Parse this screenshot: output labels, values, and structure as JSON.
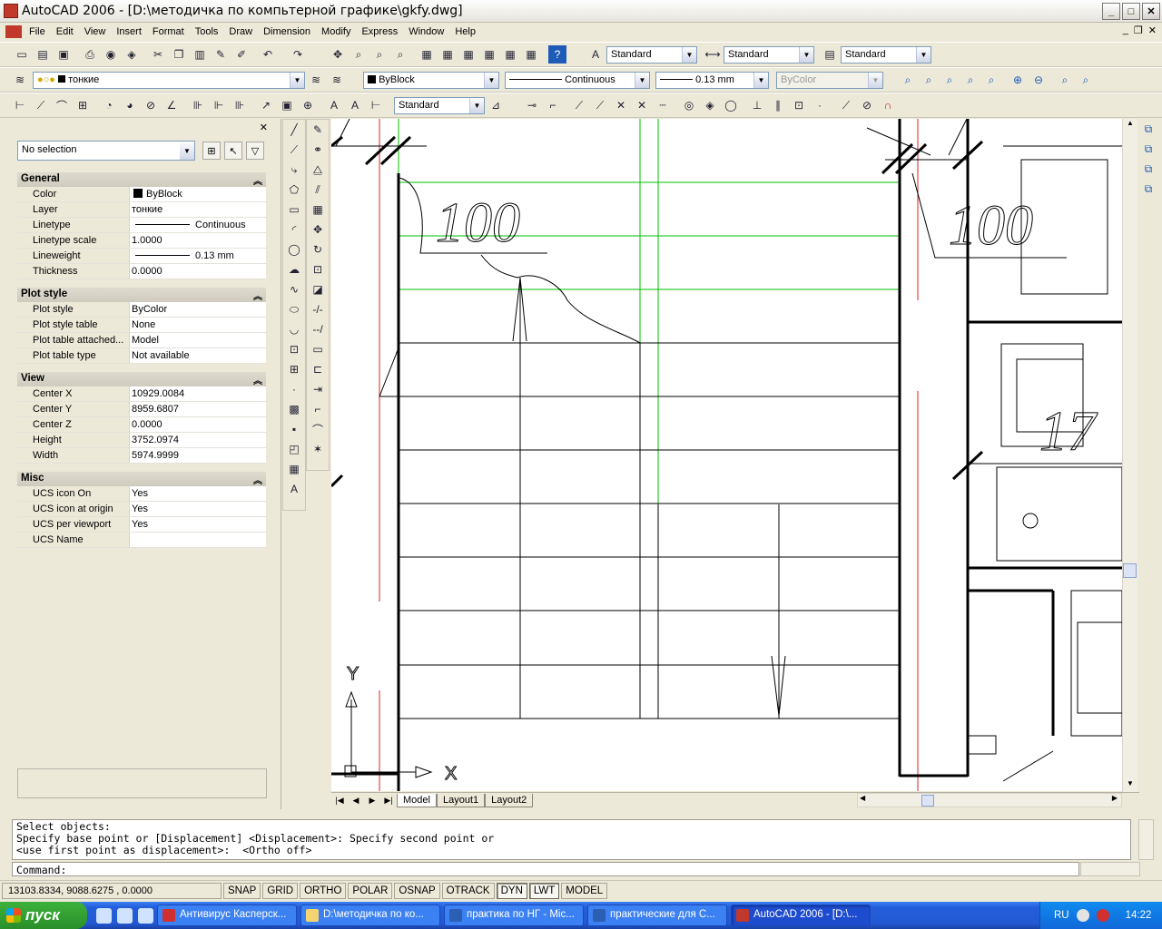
{
  "window": {
    "title": "AutoCAD 2006 - [D:\\методичка по компьтерной графике\\gkfy.dwg]",
    "icon": "autocad-logo-icon"
  },
  "menu": [
    "File",
    "Edit",
    "View",
    "Insert",
    "Format",
    "Tools",
    "Draw",
    "Dimension",
    "Modify",
    "Express",
    "Window",
    "Help"
  ],
  "styles_toolbar": {
    "text_style": "Standard",
    "dim_style": "Standard",
    "table_style": "Standard"
  },
  "layers_toolbar": {
    "current_layer": "тонкие"
  },
  "properties_toolbar": {
    "color": "ByBlock",
    "linetype": "Continuous",
    "lineweight": "0.13 mm",
    "plotstyle": "ByColor"
  },
  "dim_toolbar": {
    "dim_style": "Standard"
  },
  "properties_panel": {
    "selection": "No selection",
    "sections": [
      {
        "title": "General",
        "rows": [
          {
            "key": "Color",
            "value": "ByBlock",
            "swatch": true
          },
          {
            "key": "Layer",
            "value": "тонкие"
          },
          {
            "key": "Linetype",
            "value": "Continuous",
            "line": true
          },
          {
            "key": "Linetype scale",
            "value": "1.0000"
          },
          {
            "key": "Lineweight",
            "value": "0.13 mm",
            "line": true
          },
          {
            "key": "Thickness",
            "value": "0.0000"
          }
        ]
      },
      {
        "title": "Plot style",
        "rows": [
          {
            "key": "Plot style",
            "value": "ByColor"
          },
          {
            "key": "Plot style table",
            "value": "None"
          },
          {
            "key": "Plot table attached...",
            "value": "Model"
          },
          {
            "key": "Plot table type",
            "value": "Not available"
          }
        ]
      },
      {
        "title": "View",
        "rows": [
          {
            "key": "Center X",
            "value": "10929.0084"
          },
          {
            "key": "Center Y",
            "value": "8959.6807"
          },
          {
            "key": "Center Z",
            "value": "0.0000"
          },
          {
            "key": "Height",
            "value": "3752.0974"
          },
          {
            "key": "Width",
            "value": "5974.9999"
          }
        ]
      },
      {
        "title": "Misc",
        "rows": [
          {
            "key": "UCS icon On",
            "value": "Yes"
          },
          {
            "key": "UCS icon at origin",
            "value": "Yes"
          },
          {
            "key": "UCS per viewport",
            "value": "Yes"
          },
          {
            "key": "UCS Name",
            "value": ""
          }
        ]
      }
    ]
  },
  "drawing": {
    "label1": "100",
    "label2": "100",
    "label3": "17",
    "ucs_x": "X",
    "ucs_y": "Y"
  },
  "layout_tabs": [
    "Model",
    "Layout1",
    "Layout2"
  ],
  "command_history": "Select objects:\nSpecify base point or [Displacement] <Displacement>: Specify second point or\n<use first point as displacement>:  <Ortho off>",
  "command_prompt": "Command:",
  "status": {
    "coords": "13103.8334, 9088.6275 , 0.0000",
    "toggles": [
      {
        "label": "SNAP",
        "on": false
      },
      {
        "label": "GRID",
        "on": false
      },
      {
        "label": "ORTHO",
        "on": false
      },
      {
        "label": "POLAR",
        "on": false
      },
      {
        "label": "OSNAP",
        "on": false
      },
      {
        "label": "OTRACK",
        "on": false
      },
      {
        "label": "DYN",
        "on": true
      },
      {
        "label": "LWT",
        "on": true
      },
      {
        "label": "MODEL",
        "on": false
      }
    ]
  },
  "taskbar": {
    "start": "пуск",
    "tasks": [
      {
        "label": "Антивирус Касперск...",
        "icon": "kaspersky-icon"
      },
      {
        "label": "D:\\методичка по ко...",
        "icon": "folder-icon"
      },
      {
        "label": "практика по НГ - Mic...",
        "icon": "word-icon"
      },
      {
        "label": "практические для С...",
        "icon": "word-icon"
      },
      {
        "label": "AutoCAD 2006 - [D:\\...",
        "icon": "autocad-icon",
        "active": true
      }
    ],
    "lang": "RU",
    "time": "14:22"
  },
  "colors": {
    "accent_red": "#e02020",
    "grid_green": "#00c000"
  }
}
